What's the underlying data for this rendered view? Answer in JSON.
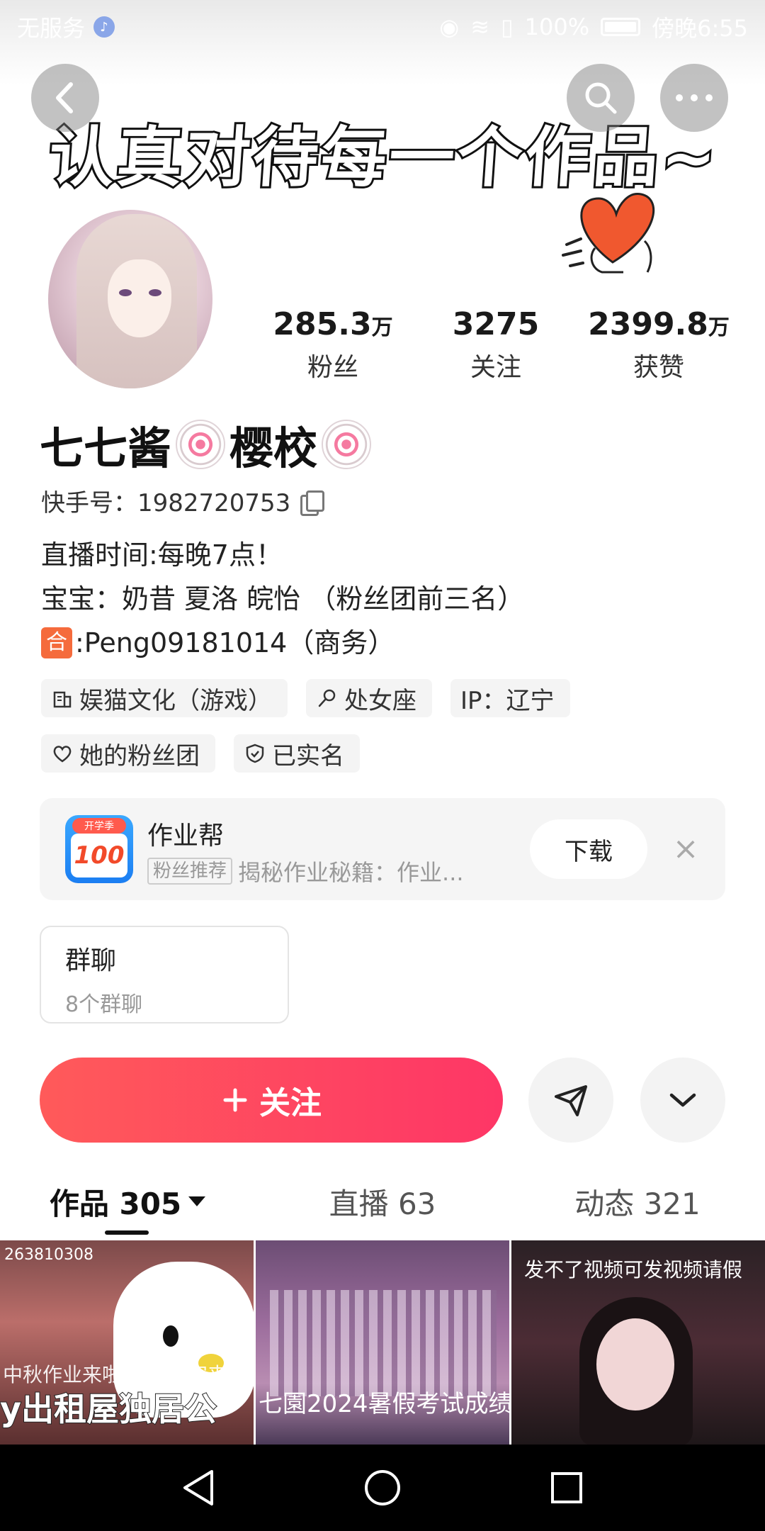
{
  "status_bar": {
    "carrier": "无服务",
    "battery": "100%",
    "time": "傍晚6:55"
  },
  "header": {
    "slogan": "认真对待每一个作品~"
  },
  "profile": {
    "stats": [
      {
        "value": "285.3",
        "unit": "万",
        "label": "粉丝"
      },
      {
        "value": "3275",
        "unit": "",
        "label": "关注"
      },
      {
        "value": "2399.8",
        "unit": "万",
        "label": "获赞"
      }
    ],
    "name_part1": "七七酱",
    "name_part2": "樱校",
    "kuaishou_id": "快手号：1982720753",
    "bio": {
      "line1": "直播时间:每晚7点！",
      "line2": "宝宝：奶昔 夏洛 皖怡 （粉丝团前三名）",
      "line3_badge": "合",
      "line3": ":Peng09181014（商务）"
    },
    "tags": {
      "company": "娱猫文化（游戏）",
      "zodiac": "处女座",
      "ip": "IP：辽宁",
      "fan_club": "她的粉丝团",
      "verified": "已实名"
    }
  },
  "ad": {
    "icon_ribbon": "开学季",
    "icon_text": "100",
    "title": "作业帮",
    "badge": "粉丝推荐",
    "subtitle": "揭秘作业秘籍：作业...",
    "download": "下载"
  },
  "group": {
    "title": "群聊",
    "subtitle": "8个群聊"
  },
  "actions": {
    "follow": "关注"
  },
  "tabs": [
    {
      "label": "作品 305"
    },
    {
      "label": "直播 63"
    },
    {
      "label": "动态 321"
    }
  ],
  "videos": [
    {
      "top_text": "263810308",
      "small_caption": "中秋作业来啦 期待大家来装",
      "caption": "y出租屋独居公"
    },
    {
      "caption": "七園2024暑假考试成绩"
    },
    {
      "top_caption": "发不了视频可发视频请假"
    }
  ],
  "colors": {
    "follow_gradient_start": "#ff5a5a",
    "follow_gradient_end": "#fe3666"
  }
}
